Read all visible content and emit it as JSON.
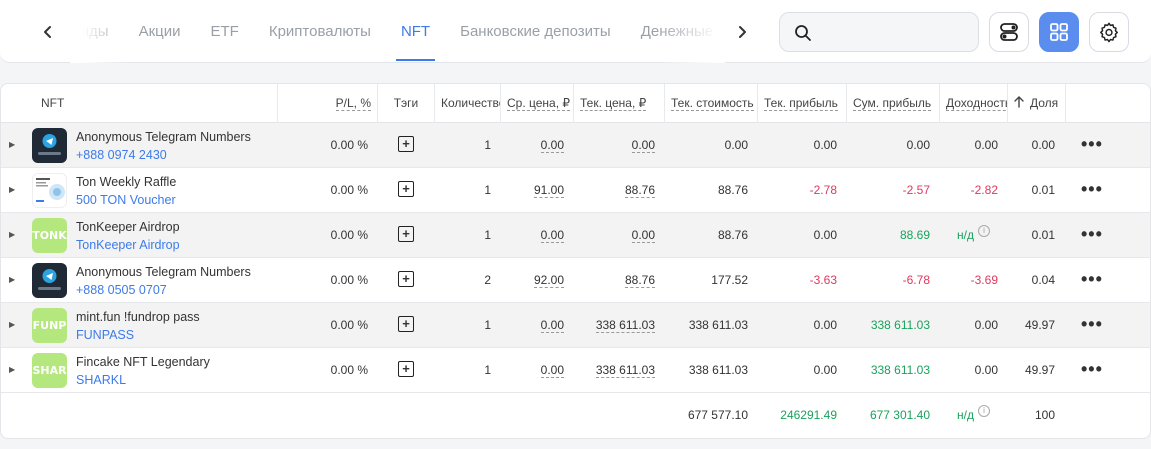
{
  "tabs": {
    "items": [
      {
        "label": "Фонды",
        "active": false
      },
      {
        "label": "Акции",
        "active": false
      },
      {
        "label": "ETF",
        "active": false
      },
      {
        "label": "Криптовалюты",
        "active": false
      },
      {
        "label": "NFT",
        "active": true
      },
      {
        "label": "Банковские депозиты",
        "active": false
      },
      {
        "label": "Денежные средства",
        "active": false
      }
    ],
    "prev_icon": "chevron-left-icon",
    "next_icon": "chevron-right-icon"
  },
  "search": {
    "value": "",
    "placeholder": "",
    "icon": "search-icon"
  },
  "toolbar": {
    "toggles_icon": "toggles-icon",
    "grid_icon": "grid-view-icon",
    "settings_icon": "gear-icon",
    "accent": "#5b8def"
  },
  "table": {
    "headers": {
      "name": "NFT",
      "pl": "P/L, %",
      "tags": "Тэги",
      "qty": "Количество",
      "avg_price": "Ср. цена, ₽",
      "cur_price": "Тек. цена, ₽",
      "cur_value": "Тек. стоимость",
      "cur_profit": "Тек. прибыль",
      "sum_profit": "Сум. прибыль",
      "yield": "Доходность",
      "share": "Доля"
    },
    "rows": [
      {
        "thumb": "telegram-numbers-icon",
        "name": "Anonymous Telegram Numbers",
        "sub": "+888 0974 2430",
        "pl": "0.00 %",
        "qty": "1",
        "avg_price": "0.00",
        "cur_price": "0.00",
        "cur_value": "0.00",
        "cur_profit": "0.00",
        "sum_profit": "0.00",
        "yield": "0.00",
        "share": "0.00"
      },
      {
        "thumb": "raffle-icon",
        "name": "Ton Weekly Raffle",
        "sub": "500 TON Voucher",
        "pl": "0.00 %",
        "qty": "1",
        "avg_price": "91.00",
        "cur_price": "88.76",
        "cur_value": "88.76",
        "cur_profit": "-2.78",
        "sum_profit": "-2.57",
        "yield": "-2.82",
        "share": "0.01"
      },
      {
        "thumb_text": "TONK",
        "name": "TonKeeper Airdrop",
        "sub": "TonKeeper Airdrop",
        "pl": "0.00 %",
        "qty": "1",
        "avg_price": "0.00",
        "cur_price": "0.00",
        "cur_value": "88.76",
        "cur_profit": "0.00",
        "sum_profit": "88.69",
        "yield": "н/д",
        "share": "0.01"
      },
      {
        "thumb": "telegram-numbers-icon",
        "name": "Anonymous Telegram Numbers",
        "sub": "+888 0505 0707",
        "pl": "0.00 %",
        "qty": "2",
        "avg_price": "92.00",
        "cur_price": "88.76",
        "cur_value": "177.52",
        "cur_profit": "-3.63",
        "sum_profit": "-6.78",
        "yield": "-3.69",
        "share": "0.04"
      },
      {
        "thumb_text": "FUNP",
        "name": "mint.fun !fundrop pass",
        "sub": "FUNPASS",
        "pl": "0.00 %",
        "qty": "1",
        "avg_price": "0.00",
        "cur_price": "338 611.03",
        "cur_value": "338 611.03",
        "cur_profit": "0.00",
        "sum_profit": "338 611.03",
        "yield": "0.00",
        "share": "49.97"
      },
      {
        "thumb_text": "SHAR",
        "name": "Fincake NFT Legendary",
        "sub": "SHARKL",
        "pl": "0.00 %",
        "qty": "1",
        "avg_price": "0.00",
        "cur_price": "338 611.03",
        "cur_value": "338 611.03",
        "cur_profit": "0.00",
        "sum_profit": "338 611.03",
        "yield": "0.00",
        "share": "49.97"
      }
    ],
    "totals": {
      "cur_value": "677 577.10",
      "cur_profit": "246291.49",
      "sum_profit": "677 301.40",
      "yield": "н/д",
      "share": "100"
    },
    "colors": {
      "negative": "#e0395f",
      "positive": "#1aa25c",
      "link": "#3d7be8"
    }
  }
}
